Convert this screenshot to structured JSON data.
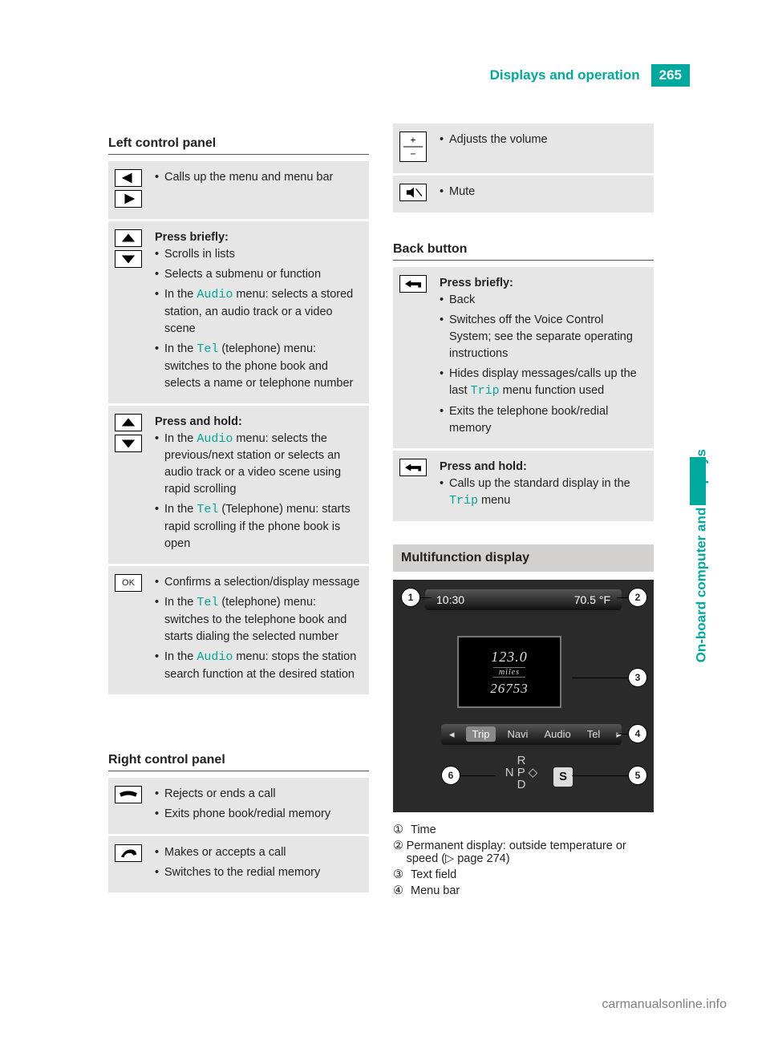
{
  "header": {
    "title": "Displays and operation",
    "page": "265",
    "side_tab": "On-board computer and displays"
  },
  "left_panel": {
    "title": "Left control panel",
    "rows": [
      {
        "icons": [
          "left",
          "right"
        ],
        "items": [
          {
            "text": "Calls up the menu and menu bar"
          }
        ]
      },
      {
        "icons": [
          "up",
          "down"
        ],
        "heading": "Press briefly:",
        "items": [
          {
            "text": "Scrolls in lists"
          },
          {
            "text": "Selects a submenu or function"
          },
          {
            "pre": "In the ",
            "hl": "Audio",
            "post": " menu: selects a stored station, an audio track or a video scene"
          },
          {
            "pre": "In the ",
            "hl": "Tel",
            "post": " (telephone) menu: switches to the phone book and selects a name or telephone number"
          }
        ]
      },
      {
        "icons": [
          "up",
          "down"
        ],
        "heading": "Press and hold:",
        "items": [
          {
            "pre": "In the ",
            "hl": "Audio",
            "post": " menu: selects the previous/next station or selects an audio track or a video scene using rapid scrolling"
          },
          {
            "pre": "In the ",
            "hl": "Tel",
            "post": " (Telephone) menu: starts rapid scrolling if the phone book is open"
          }
        ]
      },
      {
        "icons": [
          "ok"
        ],
        "items": [
          {
            "text": "Confirms a selection/display message"
          },
          {
            "pre": "In the ",
            "hl": "Tel",
            "post": " (telephone) menu: switches to the telephone book and starts dialing the selected number"
          },
          {
            "pre": "In the ",
            "hl": "Audio",
            "post": " menu: stops the station search function at the desired station"
          }
        ]
      }
    ]
  },
  "right_panel": {
    "title": "Right control panel",
    "rows": [
      {
        "icons": [
          "hangup"
        ],
        "items": [
          {
            "text": "Rejects or ends a call"
          },
          {
            "text": "Exits phone book/redial memory"
          }
        ]
      },
      {
        "icons": [
          "pickup"
        ],
        "items": [
          {
            "text": "Makes or accepts a call"
          },
          {
            "text": "Switches to the redial memory"
          }
        ]
      }
    ]
  },
  "right_panel_cont": {
    "rows": [
      {
        "icons": [
          "plusminus"
        ],
        "items": [
          {
            "text": "Adjusts the volume"
          }
        ]
      },
      {
        "icons": [
          "mute"
        ],
        "items": [
          {
            "text": "Mute"
          }
        ]
      }
    ]
  },
  "back_button": {
    "title": "Back button",
    "rows": [
      {
        "icons": [
          "back"
        ],
        "heading": "Press briefly:",
        "items": [
          {
            "text": "Back"
          },
          {
            "text": "Switches off the Voice Control System; see the separate operating instructions"
          },
          {
            "pre": "Hides display messages/calls up the last ",
            "hl": "Trip",
            "post": " menu function used"
          },
          {
            "text": "Exits the telephone book/redial memory"
          }
        ]
      },
      {
        "icons": [
          "back"
        ],
        "heading": "Press and hold:",
        "items": [
          {
            "pre": "Calls up the standard display in the ",
            "hl": "Trip",
            "post": " menu"
          }
        ]
      }
    ]
  },
  "mfd": {
    "title": "Multifunction display",
    "time": "10:30",
    "temp": "70.5 °F",
    "trip": "123.0",
    "miles_label": "miles",
    "odo": "26753",
    "menu": [
      "◂",
      "Trip",
      "Navi",
      "Audio",
      "Tel",
      "▸"
    ],
    "gears": "R\nN  P ◇\nD",
    "s": "S",
    "legend": [
      {
        "n": "①",
        "t": "Time"
      },
      {
        "n": "②",
        "t": "Permanent display: outside temperature or speed (▷ page 274)"
      },
      {
        "n": "③",
        "t": "Text field"
      },
      {
        "n": "④",
        "t": "Menu bar"
      }
    ]
  },
  "watermark": "carmanualsonline.info"
}
